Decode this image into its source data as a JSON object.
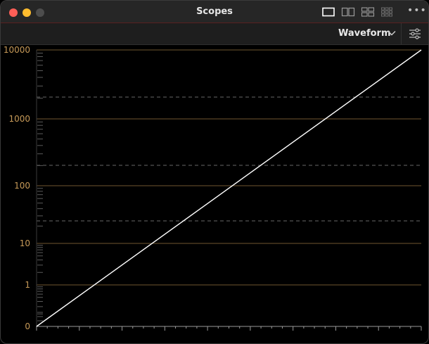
{
  "window": {
    "title": "Scopes",
    "mode_label": "Waveform",
    "more_label": "•••"
  },
  "icons": {
    "close": "close-dot-icon",
    "minimize": "minimize-dot-icon",
    "zoom": "zoom-dot-icon",
    "layout_single": "single-view-icon",
    "layout_dual": "dual-view-icon",
    "layout_quad": "quad-view-icon",
    "layout_grid": "grid-view-icon",
    "more": "more-options-icon",
    "dropdown": "chevron-down-icon",
    "settings": "settings-sliders-icon"
  },
  "colors": {
    "graticule": "#b0884b",
    "label": "#c79a58",
    "trace": "#ffffff"
  },
  "chart_data": {
    "type": "line",
    "title": "",
    "xlabel": "",
    "ylabel": "",
    "y_scale": "log",
    "y_tick_labels": [
      "0",
      "1",
      "10",
      "100",
      "1000",
      "10000"
    ],
    "series": [
      {
        "values": [
          0,
          10000
        ]
      }
    ],
    "grid": true
  }
}
